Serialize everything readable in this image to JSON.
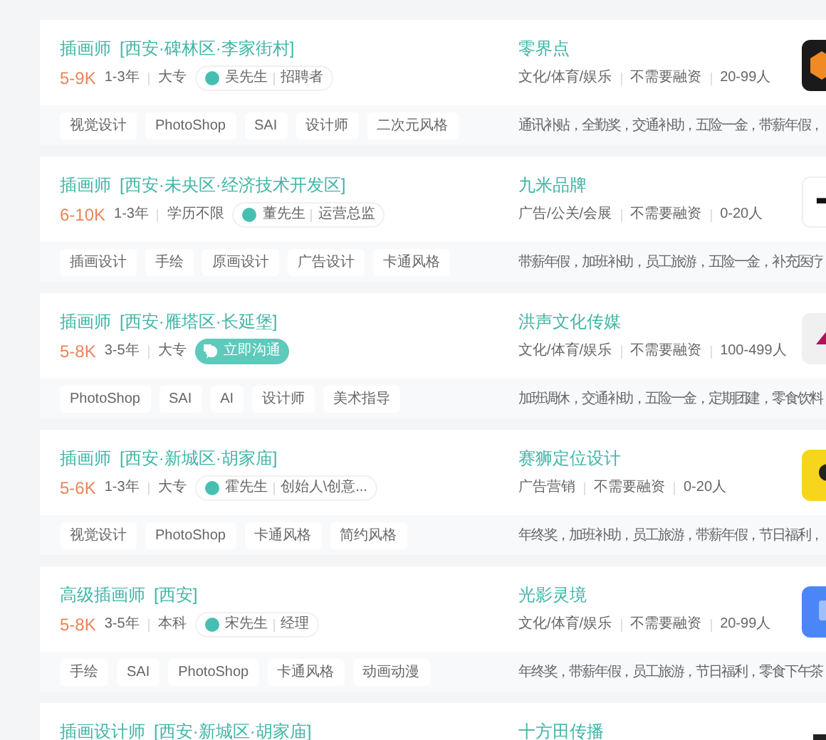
{
  "jobs": [
    {
      "title": "插画师",
      "location": "[西安·碑林区·李家街村]",
      "salary": "5-9K",
      "experience": "1-3年",
      "education": "大专",
      "contact": {
        "kind": "recruiter",
        "name": "吴先生",
        "role": "招聘者"
      },
      "tags": [
        "视觉设计",
        "PhotoShop",
        "SAI",
        "设计师",
        "二次元风格"
      ],
      "company": {
        "name": "零界点",
        "industry": "文化/体育/娱乐",
        "funding": "不需要融资",
        "size": "20-99人"
      },
      "benefits": "通讯补贴，全勤奖，交通补助，五险一金，带薪年假，"
    },
    {
      "title": "插画师",
      "location": "[西安·未央区·经济技术开发区]",
      "salary": "6-10K",
      "experience": "1-3年",
      "education": "学历不限",
      "contact": {
        "kind": "recruiter",
        "name": "董先生",
        "role": "运营总监"
      },
      "tags": [
        "插画设计",
        "手绘",
        "原画设计",
        "广告设计",
        "卡通风格"
      ],
      "company": {
        "name": "九米品牌",
        "industry": "广告/公关/会展",
        "funding": "不需要融资",
        "size": "0-20人"
      },
      "benefits": "带薪年假，加班补助，员工旅游，五险一金，补充医疗"
    },
    {
      "title": "插画师",
      "location": "[西安·雁塔区·长延堡]",
      "salary": "5-8K",
      "experience": "3-5年",
      "education": "大专",
      "contact": {
        "kind": "chat",
        "label": "立即沟通"
      },
      "tags": [
        "PhotoShop",
        "SAI",
        "AI",
        "设计师",
        "美术指导"
      ],
      "company": {
        "name": "洪声文化传媒",
        "industry": "文化/体育/娱乐",
        "funding": "不需要融资",
        "size": "100-499人"
      },
      "benefits": "加班调休，交通补助，五险一金，定期团建，零食饮料，"
    },
    {
      "title": "插画师",
      "location": "[西安·新城区·胡家庙]",
      "salary": "5-6K",
      "experience": "1-3年",
      "education": "大专",
      "contact": {
        "kind": "recruiter",
        "name": "霍先生",
        "role": "创始人\\创意..."
      },
      "tags": [
        "视觉设计",
        "PhotoShop",
        "卡通风格",
        "简约风格"
      ],
      "company": {
        "name": "赛狮定位设计",
        "industry": "广告营销",
        "funding": "不需要融资",
        "size": "0-20人"
      },
      "benefits": "年终奖，加班补助，员工旅游，带薪年假，节日福利，"
    },
    {
      "title": "高级插画师",
      "location": "[西安]",
      "salary": "5-8K",
      "experience": "3-5年",
      "education": "本科",
      "contact": {
        "kind": "recruiter",
        "name": "宋先生",
        "role": "经理"
      },
      "tags": [
        "手绘",
        "SAI",
        "PhotoShop",
        "卡通风格",
        "动画动漫"
      ],
      "company": {
        "name": "光影灵境",
        "industry": "文化/体育/娱乐",
        "funding": "不需要融资",
        "size": "20-99人"
      },
      "benefits": "年终奖，带薪年假，员工旅游，节日福利，零食下午茶，"
    },
    {
      "title": "插画设计师",
      "location": "[西安·新城区·胡家庙]",
      "company": {
        "name": "十方田传播"
      }
    }
  ]
}
